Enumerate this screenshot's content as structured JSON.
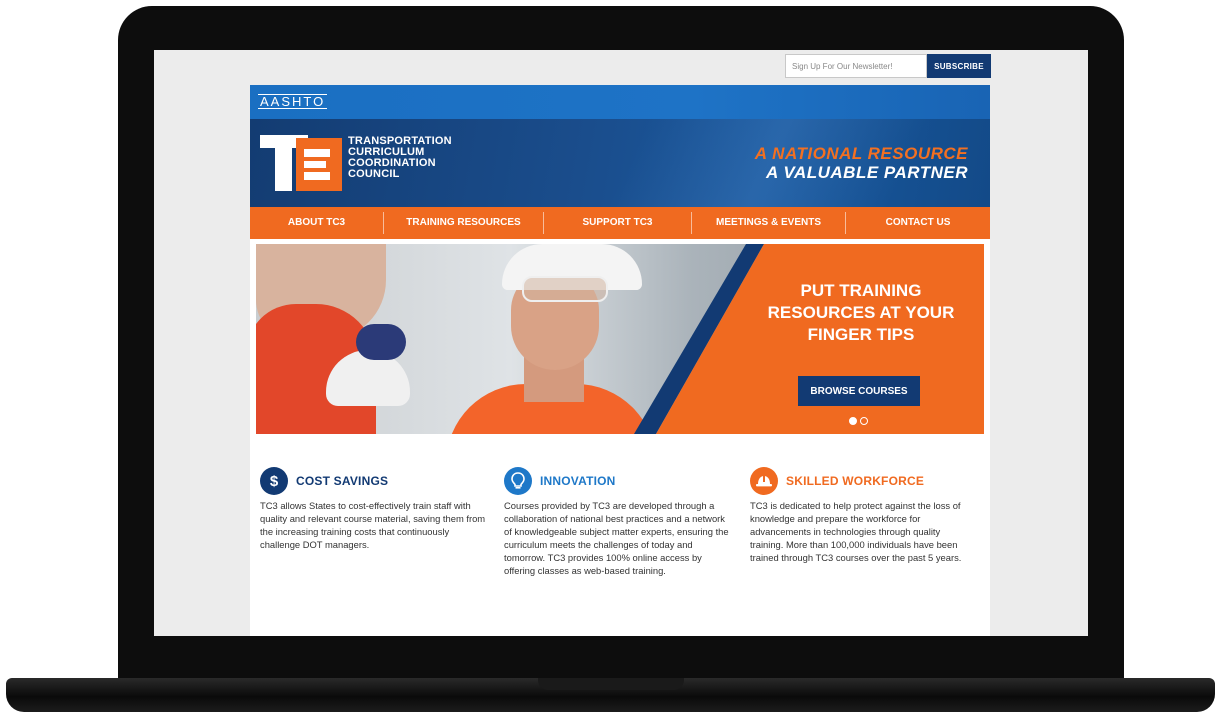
{
  "newsletter": {
    "placeholder": "Sign Up For Our Newsletter!",
    "subscribe_label": "SUBSCRIBE"
  },
  "header": {
    "aashto_logo": "AASHTO",
    "logo_text": [
      "TRANSPORTATION",
      "CURRICULUM",
      "COORDINATION",
      "COUNCIL"
    ],
    "tagline_line1": "A NATIONAL RESOURCE",
    "tagline_line2": "A VALUABLE PARTNER"
  },
  "nav": {
    "items": [
      {
        "label": "ABOUT TC3"
      },
      {
        "label": "TRAINING RESOURCES"
      },
      {
        "label": "SUPPORT TC3"
      },
      {
        "label": "MEETINGS & EVENTS"
      },
      {
        "label": "CONTACT US"
      }
    ]
  },
  "hero": {
    "headline": "PUT TRAINING RESOURCES AT YOUR FINGER TIPS",
    "button_label": "BROWSE COURSES"
  },
  "features": [
    {
      "icon": "dollar-icon",
      "icon_glyph": "$",
      "color": "#123a73",
      "title": "COST SAVINGS",
      "body": "TC3 allows States to cost-effectively train staff with quality and relevant course material, saving them from the increasing training costs that continuously challenge DOT managers."
    },
    {
      "icon": "lightbulb-icon",
      "icon_glyph": "",
      "color": "#1e78c8",
      "title": "INNOVATION",
      "body": "Courses provided by TC3 are developed through a collaboration of national best practices and a network of knowledgeable subject matter experts, ensuring the curriculum meets the challenges of today and tomorrow. TC3 provides 100% online access by offering classes as web-based training."
    },
    {
      "icon": "hardhat-icon",
      "icon_glyph": "",
      "color": "#f06a20",
      "title": "SKILLED WORKFORCE",
      "body": "TC3 is dedicated to help protect against the loss of knowledge and prepare the workforce for advancements in technologies through quality training. More than 100,000 individuals have been trained through TC3 courses over the past 5 years."
    }
  ],
  "colors": {
    "navy": "#123a73",
    "orange": "#f06a20",
    "blue": "#1e73c6"
  }
}
